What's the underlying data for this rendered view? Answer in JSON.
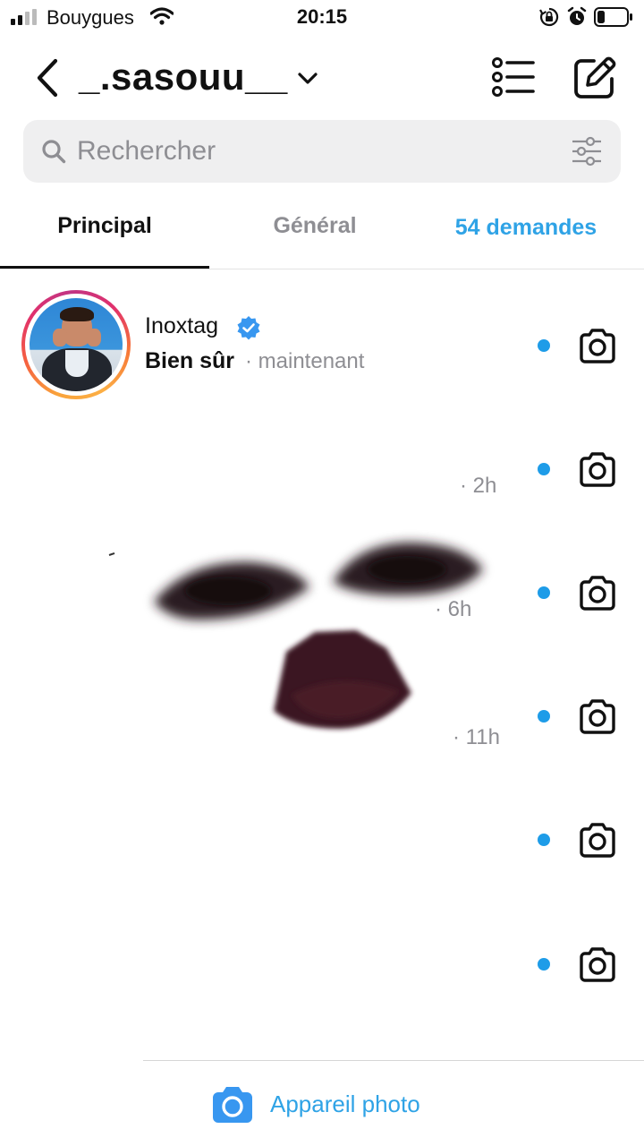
{
  "status_bar": {
    "carrier": "Bouygues",
    "time": "20:15"
  },
  "header": {
    "username": "_.sasouu__",
    "icons": [
      "back-arrow-icon",
      "chevron-down-icon",
      "list-icon",
      "compose-icon"
    ]
  },
  "search": {
    "placeholder": "Rechercher"
  },
  "tabs": [
    {
      "label": "Principal",
      "active": true
    },
    {
      "label": "Général",
      "active": false
    },
    {
      "label": "54 demandes",
      "active": false
    }
  ],
  "conversations": [
    {
      "name": "Inoxtag",
      "verified": true,
      "message": "Bien sûr",
      "time": "· maintenant",
      "unread": true
    },
    {
      "name": "",
      "message": "",
      "time": "· 2h",
      "unread": true
    },
    {
      "name": "",
      "message": "",
      "time": "· 6h",
      "unread": true
    },
    {
      "name": "",
      "message": "",
      "time": "· 11h",
      "unread": true
    },
    {
      "name": "",
      "message": "",
      "time": "",
      "unread": true
    },
    {
      "name": "",
      "message": "",
      "time": "",
      "unread": true
    }
  ],
  "bottom_bar": {
    "camera_label": "Appareil photo"
  },
  "colors": {
    "accent_blue": "#2fa3e6",
    "unread_dot": "#1e9ce8",
    "muted_text": "#8e8e93"
  }
}
